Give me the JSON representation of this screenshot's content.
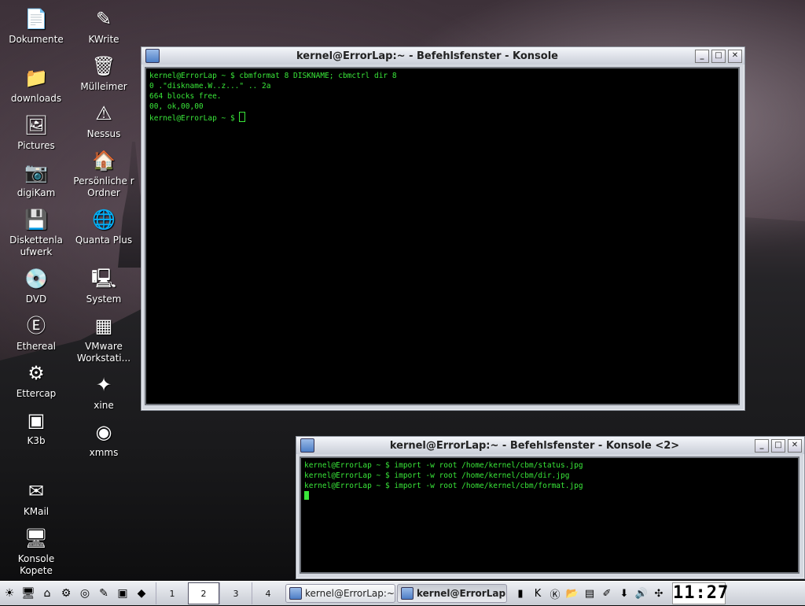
{
  "desktop": {
    "icons_col1": [
      {
        "label": "Dokumente",
        "glyph": "📄",
        "name": "dokumente-icon"
      },
      {
        "label": "downloads",
        "glyph": "📁",
        "name": "downloads-icon"
      },
      {
        "label": "Pictures",
        "glyph": "🖼",
        "name": "pictures-icon"
      },
      {
        "label": "digiKam",
        "glyph": "📷",
        "name": "digikam-icon"
      },
      {
        "label": "Diskettenla ufwerk",
        "glyph": "💾",
        "name": "floppy-icon"
      },
      {
        "label": "DVD",
        "glyph": "💿",
        "name": "dvd-icon"
      },
      {
        "label": "Ethereal",
        "glyph": "Ⓔ",
        "name": "ethereal-icon"
      },
      {
        "label": "Ettercap",
        "glyph": "⚙",
        "name": "ettercap-icon"
      },
      {
        "label": "K3b",
        "glyph": "▣",
        "name": "k3b-icon"
      },
      {
        "label": "KMail",
        "glyph": "✉",
        "name": "kmail-icon"
      },
      {
        "label": "Konsole Kopete",
        "glyph": "🖥",
        "name": "konsole-kopete-icon"
      }
    ],
    "icons_col2": [
      {
        "label": "KWrite",
        "glyph": "✎",
        "name": "kwrite-icon"
      },
      {
        "label": "Mülleimer",
        "glyph": "🗑",
        "name": "trash-icon"
      },
      {
        "label": "Nessus",
        "glyph": "⚠",
        "name": "nessus-icon"
      },
      {
        "label": "Persönliche r Ordner",
        "glyph": "🏠",
        "name": "home-folder-icon"
      },
      {
        "label": "Quanta Plus",
        "glyph": "🌐",
        "name": "quanta-plus-icon"
      },
      {
        "label": "System",
        "glyph": "🖳",
        "name": "system-icon"
      },
      {
        "label": "VMware Workstati...",
        "glyph": "▦",
        "name": "vmware-icon"
      },
      {
        "label": "xine",
        "glyph": "✦",
        "name": "xine-icon"
      },
      {
        "label": "xmms",
        "glyph": "◉",
        "name": "xmms-icon"
      }
    ]
  },
  "window1": {
    "title": "kernel@ErrorLap:~ - Befehlsfenster - Konsole",
    "lines": [
      {
        "prompt": "kernel@ErrorLap ~ $ ",
        "text": "cbmformat 8 DISKNAME; cbmctrl dir 8"
      },
      {
        "prompt": "",
        "text": "0 .\"diskname.W..z...\" .. 2a"
      },
      {
        "prompt": "",
        "text": "664 blocks free."
      },
      {
        "prompt": "",
        "text": "00, ok,00,00"
      },
      {
        "prompt": "kernel@ErrorLap ~ $ ",
        "text": ""
      }
    ]
  },
  "window2": {
    "title": "kernel@ErrorLap:~ - Befehlsfenster - Konsole <2>",
    "lines": [
      {
        "prompt": "kernel@ErrorLap ~ $ ",
        "text": "import -w root /home/kernel/cbm/status.jpg"
      },
      {
        "prompt": "kernel@ErrorLap ~ $ ",
        "text": "import -w root /home/kernel/cbm/dir.jpg"
      },
      {
        "prompt": "kernel@ErrorLap ~ $ ",
        "text": "import -w root /home/kernel/cbm/format.jpg"
      }
    ]
  },
  "taskbar": {
    "pager": [
      "1",
      "2",
      "3",
      "4"
    ],
    "tasks": [
      {
        "label": "kernel@ErrorLap:~",
        "active": false
      },
      {
        "label": "kernel@ErrorLap:",
        "active": true
      }
    ],
    "clock": "11:27"
  }
}
